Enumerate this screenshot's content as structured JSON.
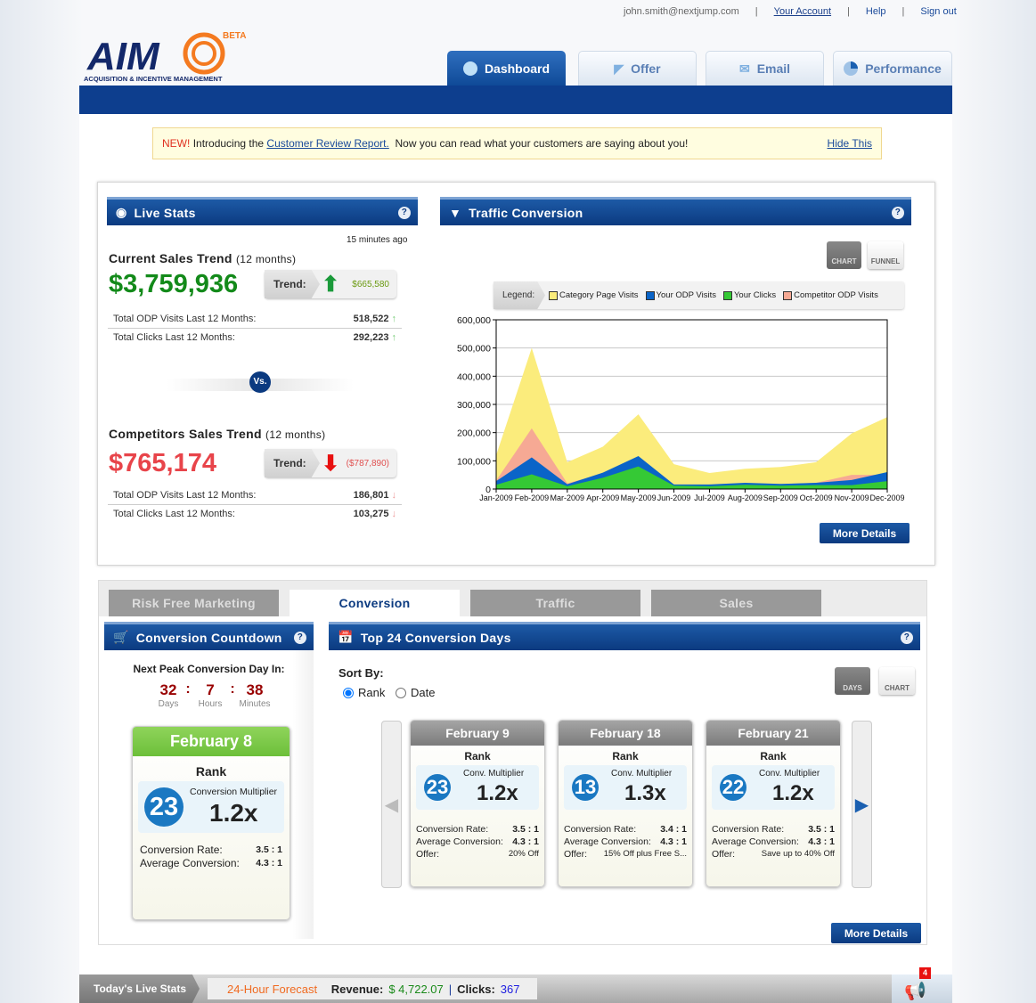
{
  "top_links": {
    "email": "john.smith@nextjump.com",
    "account": "Your Account",
    "help": "Help",
    "signout": "Sign out"
  },
  "logo": {
    "text": "AIM",
    "beta": "BETA",
    "subtitle": "ACQUISITION & INCENTIVE MANAGEMENT"
  },
  "nav_tabs": [
    {
      "label": "Dashboard",
      "icon": "gauge-icon"
    },
    {
      "label": "Offer",
      "icon": "tag-icon"
    },
    {
      "label": "Email",
      "icon": "envelope-icon"
    },
    {
      "label": "Performance",
      "icon": "pie-icon"
    }
  ],
  "notice": {
    "new": "NEW!",
    "intro": "Introducing the",
    "link": "Customer Review Report.",
    "rest": "Now you can read what your customers are saying about you!",
    "hide": "Hide This"
  },
  "live_stats": {
    "title": "Live Stats",
    "updated": "15 minutes ago",
    "current": {
      "title": "Current Sales Trend",
      "period": "(12 months)",
      "amount": "$3,759,936",
      "trend_label": "Trend:",
      "trend_value": "$665,580",
      "rows": [
        {
          "label": "Total ODP Visits Last 12 Months:",
          "value": "518,522"
        },
        {
          "label": "Total Clicks Last 12 Months:",
          "value": "292,223"
        }
      ]
    },
    "vs": "Vs.",
    "competitor": {
      "title": "Competitors Sales Trend",
      "period": "(12 months)",
      "amount": "$765,174",
      "trend_label": "Trend:",
      "trend_value": "($787,890)",
      "rows": [
        {
          "label": "Total ODP Visits Last 12 Months:",
          "value": "186,801"
        },
        {
          "label": "Total Clicks Last 12 Months:",
          "value": "103,275"
        }
      ]
    }
  },
  "traffic": {
    "title": "Traffic Conversion",
    "chart_btn": "CHART",
    "funnel_btn": "FUNNEL",
    "legend_label": "Legend:",
    "more": "More Details"
  },
  "chart_data": {
    "type": "area",
    "title": "Traffic Conversion",
    "x": [
      "Jan-2009",
      "Feb-2009",
      "Mar-2009",
      "Apr-2009",
      "May-2009",
      "Jun-2009",
      "Jul-2009",
      "Aug-2009",
      "Sep-2009",
      "Oct-2009",
      "Nov-2009",
      "Dec-2009"
    ],
    "ylim": [
      0,
      600000
    ],
    "yticks": [
      "0",
      "100,000",
      "200,000",
      "300,000",
      "400,000",
      "500,000",
      "600,000"
    ],
    "grid": true,
    "legend": "top",
    "series": [
      {
        "name": "Category Page Visits",
        "color": "#fbec7c",
        "values": [
          120000,
          500000,
          95000,
          150000,
          265000,
          88000,
          57000,
          72000,
          78000,
          95000,
          197000,
          255000
        ]
      },
      {
        "name": "Competitor ODP Visits",
        "color": "#f6a994",
        "values": [
          30000,
          215000,
          20000,
          55000,
          115000,
          15000,
          15000,
          20000,
          17000,
          22000,
          50000,
          50000
        ]
      },
      {
        "name": "Your ODP Visits",
        "color": "#0a64c8",
        "values": [
          28000,
          112000,
          17000,
          58000,
          117000,
          16000,
          16000,
          22000,
          18000,
          22000,
          32000,
          60000
        ]
      },
      {
        "name": "Your Clicks",
        "color": "#35c935",
        "values": [
          15000,
          52000,
          10000,
          40000,
          80000,
          12000,
          10000,
          15000,
          12000,
          14000,
          14000,
          28000
        ]
      }
    ]
  },
  "bottom_tabs": [
    "Risk Free Marketing",
    "Conversion",
    "Traffic",
    "Sales"
  ],
  "countdown": {
    "title": "Conversion Countdown",
    "next": "Next Peak Conversion Day In:",
    "days": "32",
    "hours": "7",
    "minutes": "38",
    "days_label": "Days",
    "hours_label": "Hours",
    "minutes_label": "Minutes",
    "card": {
      "date": "February 8",
      "rank_label": "Rank",
      "rank": "23",
      "mult_label": "Conversion Multiplier",
      "mult": "1.2x",
      "rate_label": "Conversion Rate:",
      "rate": "3.5 : 1",
      "avg_label": "Average Conversion:",
      "avg": "4.3 : 1"
    }
  },
  "top24": {
    "title": "Top 24 Conversion Days",
    "sort_label": "Sort By:",
    "sort_options": [
      "Rank",
      "Date"
    ],
    "sort_selected": "Rank",
    "days_btn": "DAYS",
    "chart_btn": "CHART",
    "more": "More Details",
    "cards": [
      {
        "date": "February 9",
        "rank_label": "Rank",
        "rank": "23",
        "mult_label": "Conv. Multiplier",
        "mult": "1.2x",
        "rate_label": "Conversion Rate:",
        "rate": "3.5 : 1",
        "avg_label": "Average Conversion:",
        "avg": "4.3 : 1",
        "offer_label": "Offer:",
        "offer": "20% Off"
      },
      {
        "date": "February 18",
        "rank_label": "Rank",
        "rank": "13",
        "mult_label": "Conv. Multiplier",
        "mult": "1.3x",
        "rate_label": "Conversion Rate:",
        "rate": "3.4 : 1",
        "avg_label": "Average Conversion:",
        "avg": "4.3 : 1",
        "offer_label": "Offer:",
        "offer": "15% Off plus Free S..."
      },
      {
        "date": "February 21",
        "rank_label": "Rank",
        "rank": "22",
        "mult_label": "Conv. Multiplier",
        "mult": "1.2x",
        "rate_label": "Conversion Rate:",
        "rate": "3.5 : 1",
        "avg_label": "Average Conversion:",
        "avg": "4.3 : 1",
        "offer_label": "Offer:",
        "offer": "Save up to 40% Off"
      }
    ]
  },
  "footer": {
    "live": "Today's Live Stats",
    "forecast": "24-Hour Forecast",
    "revenue_label": "Revenue:",
    "revenue": "$ 4,722.07",
    "clicks_label": "Clicks:",
    "clicks": "367",
    "notifications": "4"
  }
}
